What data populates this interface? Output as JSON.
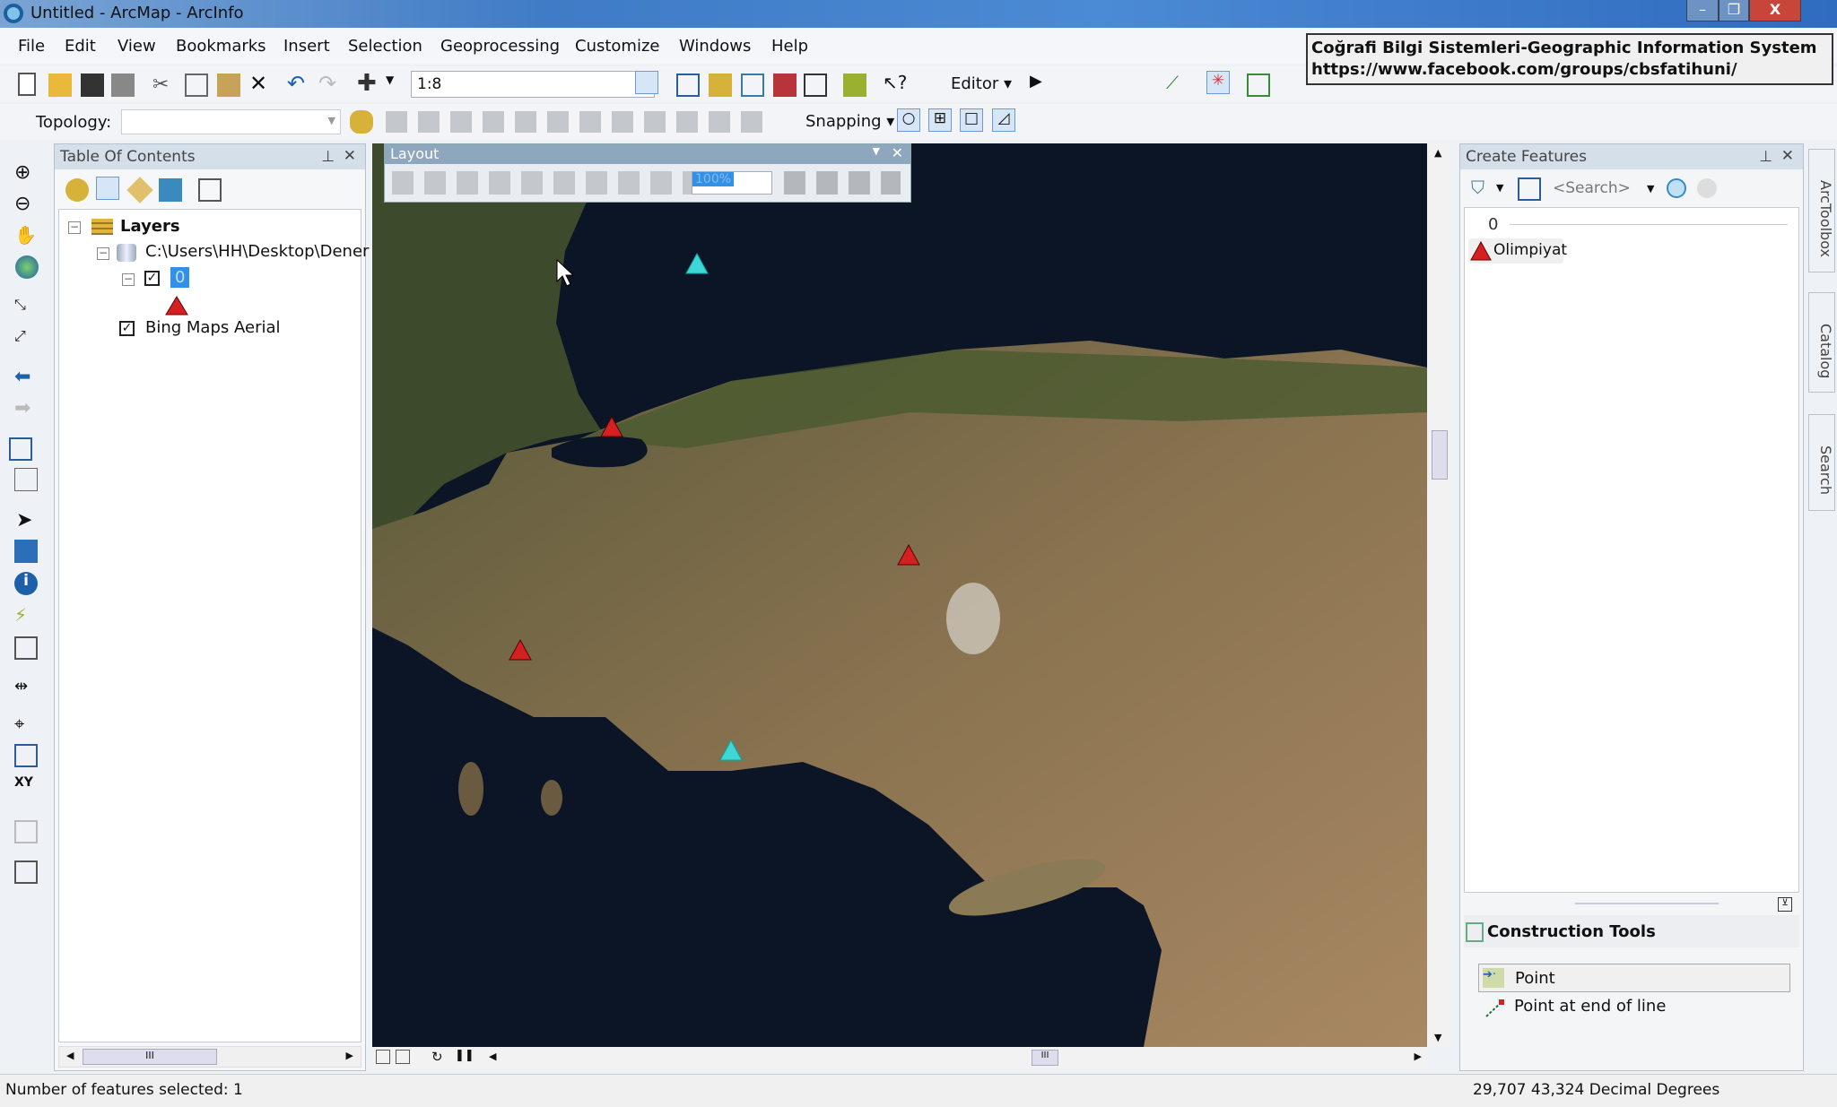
{
  "window": {
    "title": "Untitled - ArcMap - ArcInfo",
    "minimize": "–",
    "restore": "❐",
    "close": "X"
  },
  "menu": [
    "File",
    "Edit",
    "View",
    "Bookmarks",
    "Insert",
    "Selection",
    "Geoprocessing",
    "Customize",
    "Windows",
    "Help"
  ],
  "toolbar": {
    "scale": "1:8",
    "editor_label": "Editor",
    "topology_label": "Topology:",
    "snapping_label": "Snapping"
  },
  "tooltip": {
    "line1": "Coğrafi Bilgi Sistemleri-Geographic Information System",
    "line2": "https://www.facebook.com/groups/cbsfatihuni/"
  },
  "toc": {
    "title": "Table Of Contents",
    "root": "Layers",
    "path": "C:\\Users\\HH\\Desktop\\Dener",
    "layer": "0",
    "basemap": "Bing Maps Aerial",
    "scroll_mark": "III"
  },
  "layout_toolbar": {
    "title": "Layout",
    "zoom_value": "100%"
  },
  "create_features": {
    "title": "Create Features",
    "search_placeholder": "<Search>",
    "group": "0",
    "template": "Olimpiyat"
  },
  "construction_tools": {
    "title": "Construction Tools",
    "items": [
      "Point",
      "Point at end of line"
    ]
  },
  "right_tabs": [
    "ArcToolbox",
    "Catalog",
    "Search"
  ],
  "status": {
    "left": "Number of features selected: 1",
    "coords": "29,707  43,324 Decimal Degrees"
  },
  "map": {
    "scroll_mark": "III",
    "points": [
      {
        "type": "selected",
        "color": "#3fd6d6"
      },
      {
        "type": "normal",
        "color": "#d42020"
      },
      {
        "type": "normal",
        "color": "#d42020"
      },
      {
        "type": "normal",
        "color": "#d42020"
      },
      {
        "type": "selected",
        "color": "#3fd6d6"
      }
    ]
  }
}
